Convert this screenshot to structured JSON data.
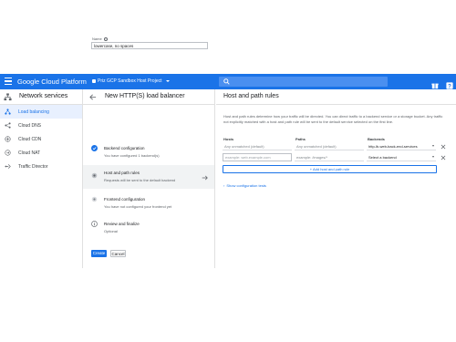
{
  "topbar": {
    "brand": "Google Cloud Platform",
    "project": "Priz GCP Sandbox Host Project",
    "icons": [
      "menu-icon",
      "search-icon",
      "gift-icon",
      "help-icon"
    ]
  },
  "sidenav": {
    "title": "Network services",
    "items": [
      {
        "label": "Load balancing",
        "icon": "load-balancing-icon",
        "active": true
      },
      {
        "label": "Cloud DNS",
        "icon": "dns-icon",
        "active": false
      },
      {
        "label": "Cloud CDN",
        "icon": "cdn-icon",
        "active": false
      },
      {
        "label": "Cloud NAT",
        "icon": "nat-icon",
        "active": false
      },
      {
        "label": "Traffic Director",
        "icon": "traffic-director-icon",
        "active": false
      }
    ]
  },
  "wizard": {
    "title": "New HTTP(S) load balancer",
    "name_label": "Name",
    "name_value": "lowercase, no spaces",
    "steps": [
      {
        "title": "Backend configuration",
        "subtitle": "You have configured 1 backend(s)",
        "status": "done"
      },
      {
        "title": "Host and path rules",
        "subtitle": "Requests will be sent to the default backend",
        "status": "active"
      },
      {
        "title": "Frontend configuration",
        "subtitle": "You have not configured your frontend yet",
        "status": "pending"
      },
      {
        "title": "Review and finalize",
        "subtitle": "Optional",
        "status": "info"
      }
    ],
    "create": "Create",
    "cancel": "Cancel"
  },
  "main": {
    "title": "Host and path rules",
    "description": "Host and path rules determine how your traffic will be directed. You can direct traffic to a backend service or a storage bucket. Any traffic not explicitly matched with a host and path rule will be sent to the default service selected on the first line.",
    "columns": {
      "hosts": "Hosts",
      "paths": "Paths",
      "backends": "Backends"
    },
    "rows": [
      {
        "hosts": "Any unmatched (default)",
        "paths": "Any unmatched (default)",
        "backend": "http-lb-web-back-end-services"
      },
      {
        "hosts": "example: web.example.com",
        "paths": "example: /images/*",
        "backend": "Select a backend"
      }
    ],
    "add_rule": "+ Add host and path rule",
    "show_tests": "Show configuration tests"
  }
}
